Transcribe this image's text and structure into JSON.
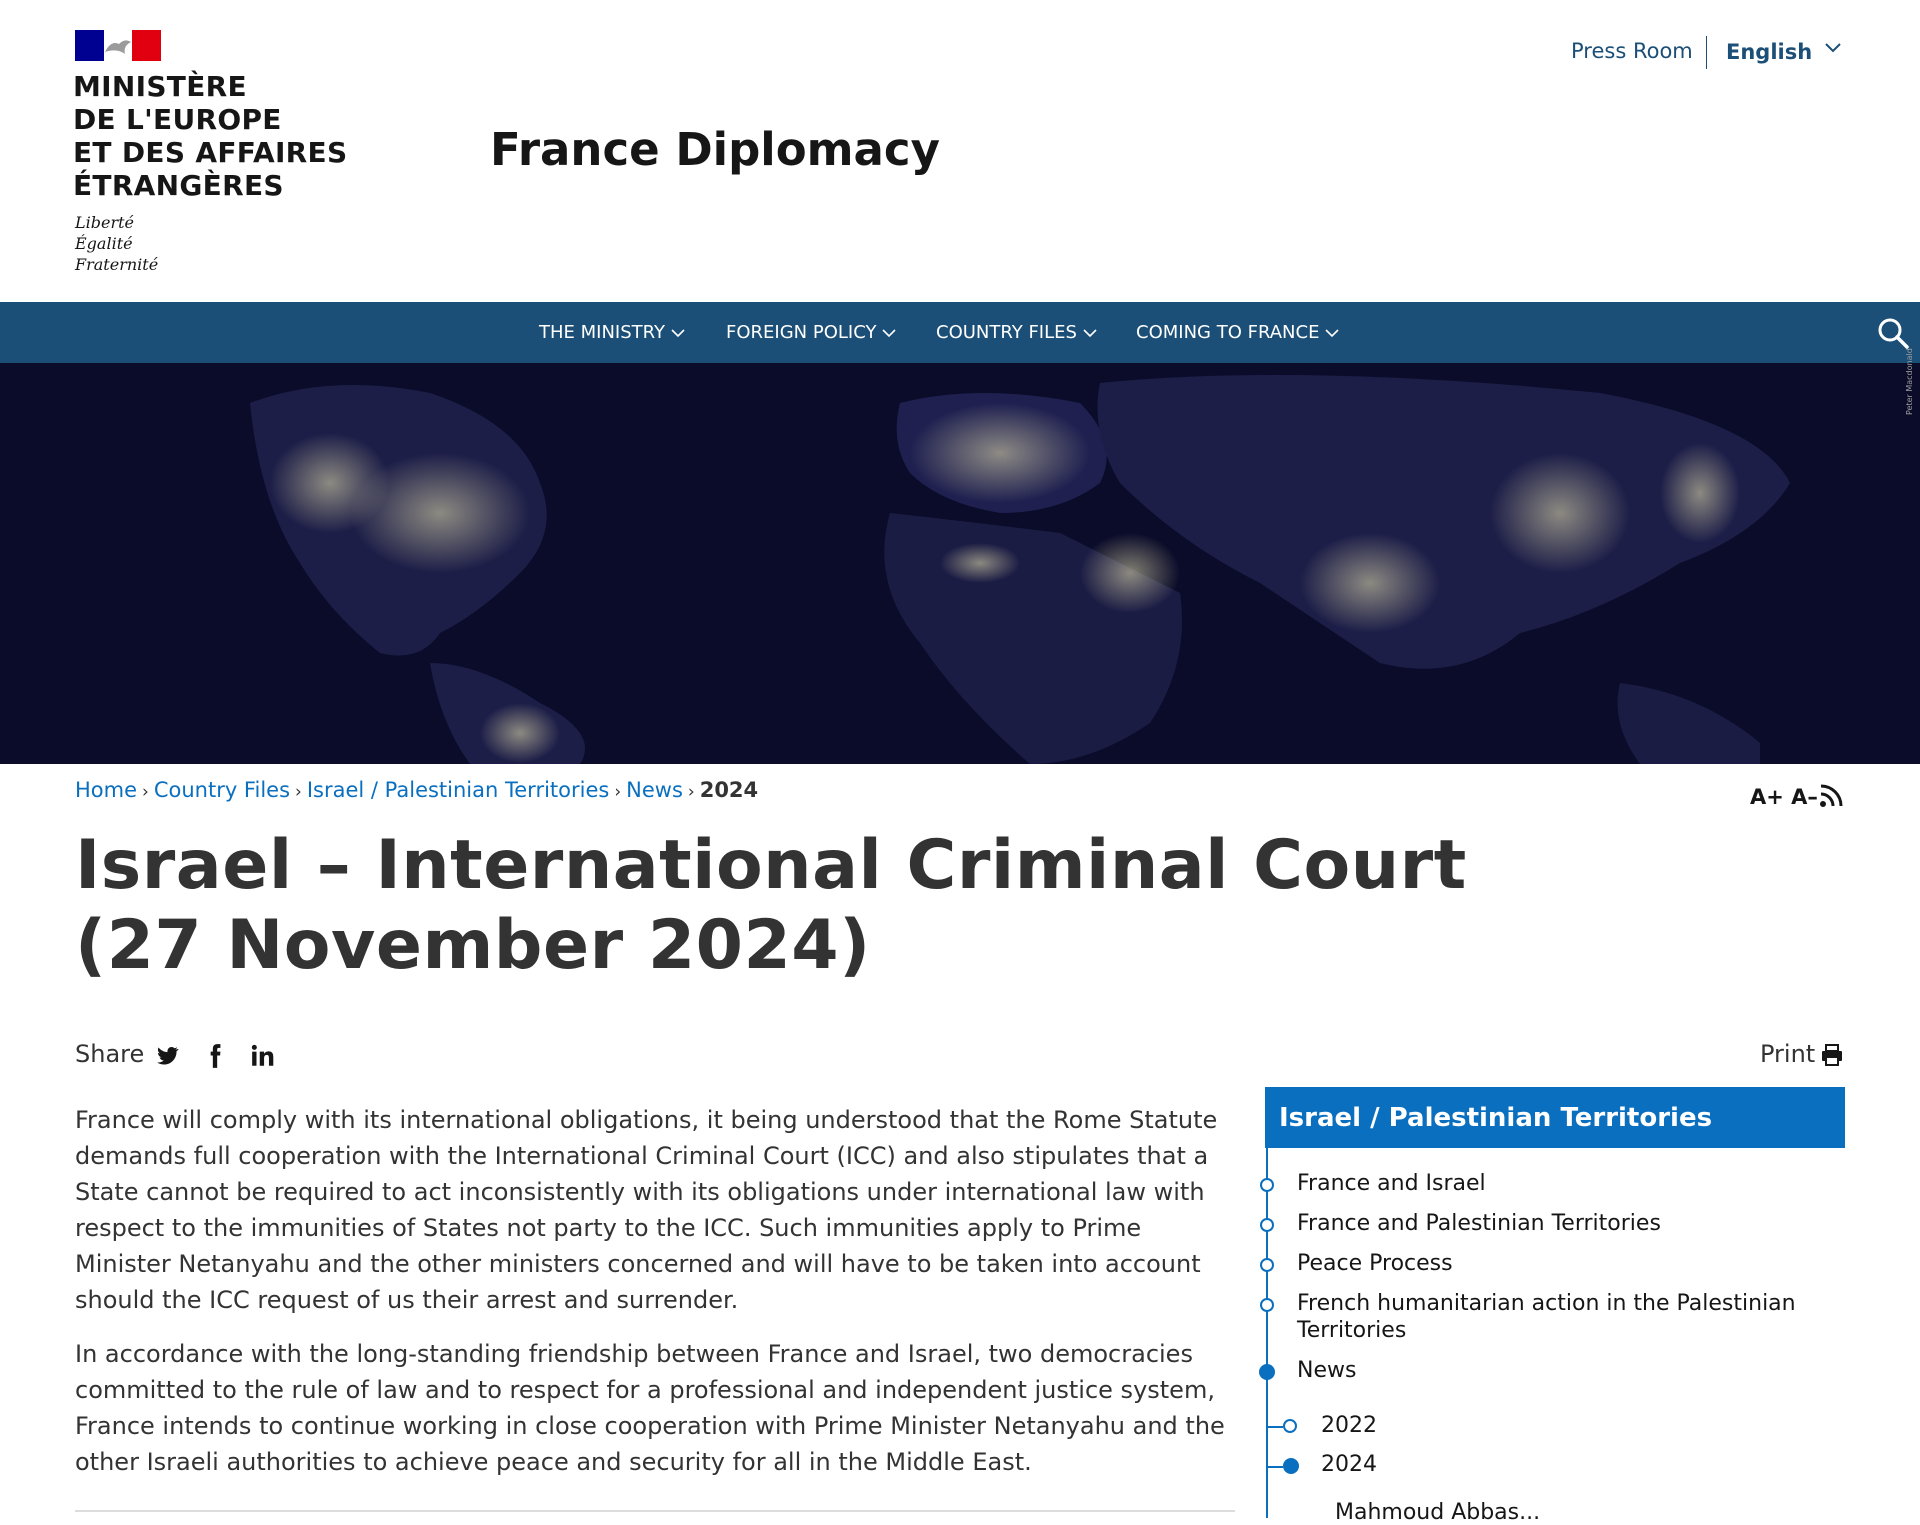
{
  "header": {
    "ministry_name": "MINISTÈRE\nDE L'EUROPE\nET DES AFFAIRES\nÉTRANGÈRES",
    "motto": "Liberté\nÉgalité\nFraternité",
    "site_title": "France Diplomacy",
    "press_room": "Press Room",
    "language": "English"
  },
  "nav": {
    "items": [
      {
        "label": "THE MINISTRY"
      },
      {
        "label": "FOREIGN POLICY"
      },
      {
        "label": "COUNTRY FILES"
      },
      {
        "label": "COMING TO FRANCE"
      }
    ]
  },
  "hero": {
    "photo_credit": "Peter Macdonald"
  },
  "breadcrumb": {
    "items": [
      "Home",
      "Country Files",
      "Israel / Palestinian Territories",
      "News"
    ],
    "current": "2024"
  },
  "tools": {
    "increase": "A+",
    "decrease": "A–"
  },
  "article": {
    "title": "Israel – International Criminal Court (27 November 2024)",
    "share_label": "Share",
    "print_label": "Print",
    "paragraphs": [
      "France will comply with its international obligations, it being understood that the Rome Statute demands full cooperation with the International Criminal Court (ICC) and also stipulates that a State cannot be required to act inconsistently with its obligations under international law with respect to the immunities of States not party to the ICC. Such immunities apply to Prime Minister Netanyahu and the other ministers concerned and will have to be taken into account should the ICC request of us their arrest and surrender.",
      "In accordance with the long-standing friendship between France and Israel, two democracies committed to the rule of law and to respect for a professional and independent justice system, France intends to continue working in close cooperation with Prime Minister Netanyahu and the other Israeli authorities to achieve peace and security for all in the Middle East."
    ]
  },
  "sidebar": {
    "title": "Israel / Palestinian Territories",
    "items": [
      {
        "label": "France and Israel"
      },
      {
        "label": "France and Palestinian Territories"
      },
      {
        "label": "Peace Process"
      },
      {
        "label": "French humanitarian action in the Palestinian Territories"
      },
      {
        "label": "News"
      }
    ],
    "subitems": [
      {
        "label": "2022"
      },
      {
        "label": "2024"
      }
    ],
    "partial_item": "Mahmoud Abbas..."
  },
  "colors": {
    "nav_bg": "#1c4f77",
    "link": "#0b6fbf",
    "sidebar_head": "#0b6fbf",
    "flag_blue": "#000091",
    "flag_red": "#e1000f"
  }
}
